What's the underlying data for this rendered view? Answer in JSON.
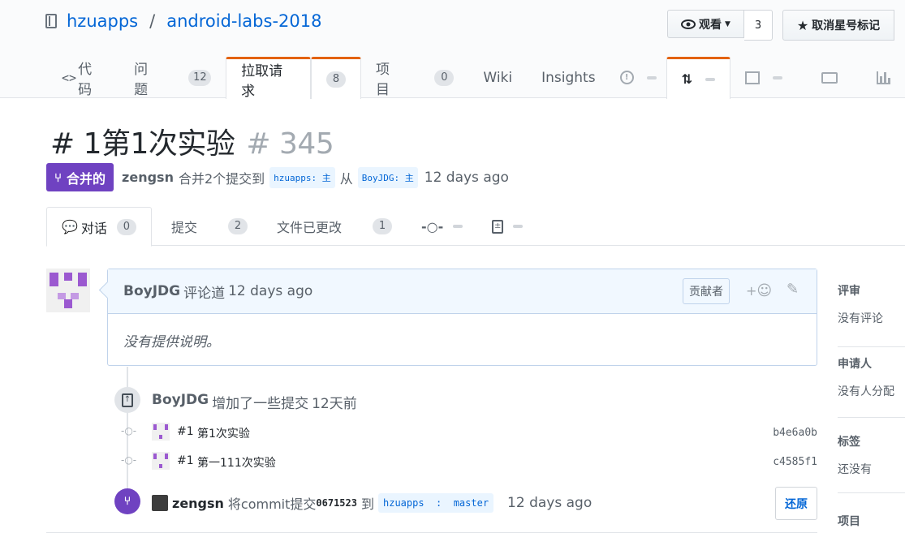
{
  "repo": {
    "owner": "hzuapps",
    "separator": "/",
    "name": "android-labs-2018"
  },
  "header_buttons": {
    "watch_label": "观看",
    "watch_count": "3",
    "star_label": "取消星号标记"
  },
  "repo_tabs": [
    {
      "label": "代码",
      "count": ""
    },
    {
      "label": "问题",
      "count": "12"
    },
    {
      "label": "拉取请求",
      "count": "8"
    },
    {
      "label": "项目",
      "count": "0"
    },
    {
      "label": "Wiki",
      "count": ""
    },
    {
      "label": "Insights",
      "count": ""
    }
  ],
  "pr": {
    "title": "# 1第1次实验",
    "number": "# 345",
    "state": "合并的",
    "author": "zengsn",
    "merged_text": "合并2个提交到",
    "base_ref": "hzuapps: 主",
    "from_text": "从",
    "head_ref": "BoyJDG: 主",
    "time": "12 days ago"
  },
  "pr_tabs": [
    {
      "label": "对话",
      "count": "0"
    },
    {
      "label": "提交",
      "count": "2"
    },
    {
      "label": "文件已更改",
      "count": "1"
    }
  ],
  "comment": {
    "author": "BoyJDG",
    "action": "评论道",
    "time": "12 days ago",
    "role": "贡献者",
    "reaction": "+",
    "body": "没有提供说明。"
  },
  "commits_event": {
    "author": "BoyJDG",
    "text": "增加了一些提交",
    "time": "12天前",
    "commits": [
      {
        "prefix": "#1",
        "message": "第1次实验",
        "sha": "b4e6a0b"
      },
      {
        "prefix": "#1",
        "message": "第一111次实验",
        "sha": "c4585f1"
      }
    ]
  },
  "merge_event": {
    "author": "zengsn",
    "text": "将commit提交",
    "sha": "0671523",
    "to": "到",
    "ref": "hzuapps  :  master",
    "time": "12 days ago",
    "revert_label": "还原"
  },
  "sidebar": {
    "reviewers_head": "评审",
    "reviewers_val": "没有评论",
    "assignees_head": "申请人",
    "assignees_val": "没有人分配",
    "labels_head": "标签",
    "labels_val": "还没有",
    "projects_head": "项目"
  },
  "colors": {
    "merged": "#6f42c1",
    "link": "#0366d6",
    "tab_accent": "#e36209"
  }
}
